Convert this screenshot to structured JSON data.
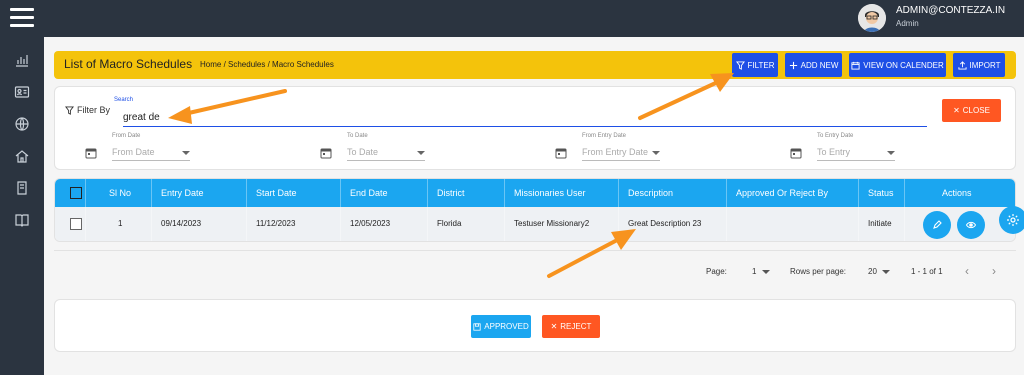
{
  "header": {
    "user_email": "ADMIN@CONTEZZA.IN",
    "user_role": "Admin"
  },
  "sidebar": {
    "icons": [
      "menu-icon",
      "chart-icon",
      "id-card-icon",
      "globe-icon",
      "home-icon",
      "book-icon",
      "open-book-icon"
    ]
  },
  "titlebar": {
    "title": "List of Macro Schedules",
    "breadcrumb": "Home / Schedules / Macro Schedules",
    "filter_label": "FILTER",
    "add_new_label": "ADD NEW",
    "view_calendar_label": "VIEW ON CALENDER",
    "import_label": "IMPORT"
  },
  "filter_panel": {
    "filter_by_label": "Filter By",
    "search_label": "Search",
    "search_value": "great de",
    "close_label": "CLOSE",
    "fields": [
      {
        "label": "From Date",
        "placeholder": "From Date"
      },
      {
        "label": "To Date",
        "placeholder": "To Date"
      },
      {
        "label": "From Entry Date",
        "placeholder": "From Entry Date"
      },
      {
        "label": "To Entry Date",
        "placeholder": "To Entry"
      }
    ]
  },
  "table": {
    "columns": [
      "Sl No",
      "Entry Date",
      "Start Date",
      "End Date",
      "District",
      "Missionaries User",
      "Description",
      "Approved Or Reject By",
      "Status",
      "Actions"
    ],
    "rows": [
      {
        "sl_no": "1",
        "entry_date": "09/14/2023",
        "start_date": "11/12/2023",
        "end_date": "12/05/2023",
        "district": "Florida",
        "missionaries_user": "Testuser Missionary2",
        "description": "Great Description 23",
        "approved_by": "",
        "status": "Initiate"
      }
    ]
  },
  "pagination": {
    "page_label": "Page:",
    "page_value": "1",
    "rows_label": "Rows per page:",
    "rows_value": "20",
    "range": "1 - 1 of 1"
  },
  "footer_actions": {
    "approved_label": "APPROVED",
    "reject_label": "REJECT"
  },
  "colors": {
    "sidebar": "#2b3440",
    "title_bar": "#f4c30b",
    "primary_button": "#1e4fe6",
    "table_header": "#1ba6f0",
    "danger": "#ff5722",
    "arrow": "#f7931e"
  }
}
